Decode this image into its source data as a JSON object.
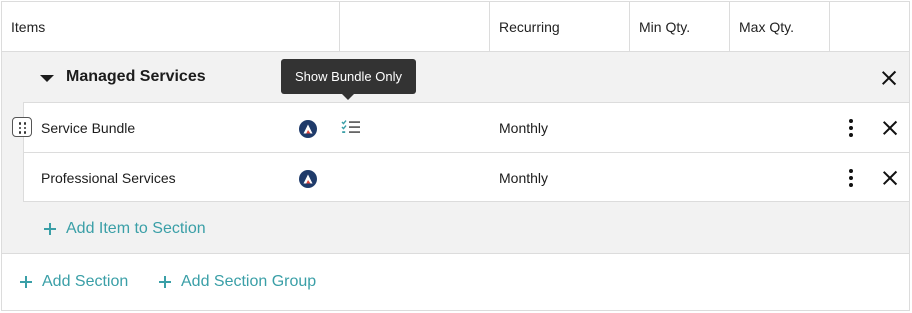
{
  "header": {
    "items": "Items",
    "blank": "",
    "recurring": "Recurring",
    "min_qty": "Min Qty.",
    "max_qty": "Max Qty."
  },
  "section": {
    "title": "Managed Services",
    "rows": [
      {
        "name": "Service Bundle",
        "recurring": "Monthly"
      },
      {
        "name": "Professional Services",
        "recurring": "Monthly"
      }
    ],
    "add_item_label": "Add Item to Section"
  },
  "footer": {
    "add_section_label": "Add Section",
    "add_section_group_label": "Add Section Group"
  },
  "tooltip": {
    "text": "Show Bundle Only"
  },
  "colors": {
    "accent": "#3a9fa7",
    "tooltip_bg": "#333333",
    "brand_icon": "#1f3b6a",
    "section_bg": "#f2f2f2"
  },
  "icons": {
    "collapse": "caret-down-icon",
    "remove": "close-icon",
    "drag": "drag-handle-icon",
    "brand": "brand-logo-icon",
    "bundle": "checklist-icon",
    "more": "kebab-menu-icon",
    "add": "plus-icon"
  }
}
